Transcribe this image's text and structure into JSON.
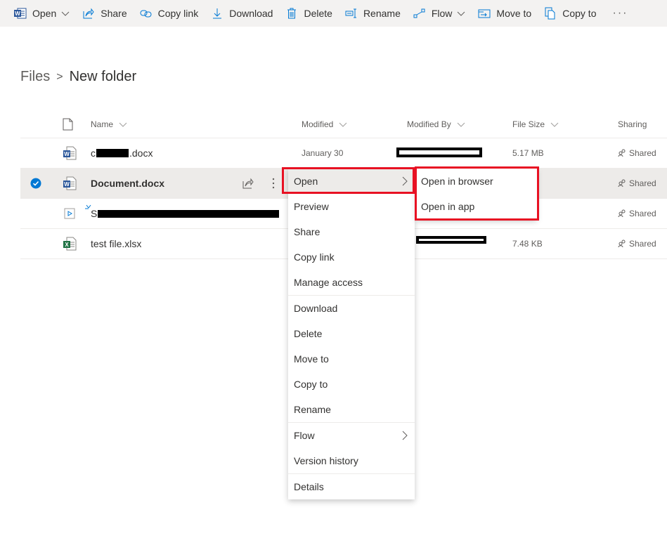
{
  "toolbar": {
    "items": [
      {
        "label": "Open",
        "icon": "word-icon",
        "dropdown": true
      },
      {
        "label": "Share",
        "icon": "share-icon"
      },
      {
        "label": "Copy link",
        "icon": "link-icon"
      },
      {
        "label": "Download",
        "icon": "download-icon"
      },
      {
        "label": "Delete",
        "icon": "trash-icon"
      },
      {
        "label": "Rename",
        "icon": "rename-icon"
      },
      {
        "label": "Flow",
        "icon": "flow-icon",
        "dropdown": true
      },
      {
        "label": "Move to",
        "icon": "move-icon"
      },
      {
        "label": "Copy to",
        "icon": "copy-icon"
      }
    ],
    "more": "···"
  },
  "breadcrumb": {
    "root": "Files",
    "separator": ">",
    "current": "New folder"
  },
  "columns": {
    "name": "Name",
    "modified": "Modified",
    "modified_by": "Modified By",
    "file_size": "File Size",
    "sharing": "Sharing"
  },
  "files": [
    {
      "name_prefix": "c",
      "name_suffix": ".docx",
      "type": "word",
      "modified": "January 30",
      "size": "5.17 MB",
      "sharing": "Shared"
    },
    {
      "name": "Document.docx",
      "type": "word",
      "modified": "",
      "size": "",
      "sharing": "Shared",
      "selected": true
    },
    {
      "name_prefix": "S",
      "type": "video",
      "modified": "",
      "size": "",
      "sharing": "Shared"
    },
    {
      "name": "test file.xlsx",
      "type": "excel",
      "modified": "",
      "size": "7.48 KB",
      "sharing": "Shared"
    }
  ],
  "context_menu": {
    "items": [
      {
        "label": "Open",
        "submenu": true
      },
      {
        "label": "Preview"
      },
      {
        "label": "Share"
      },
      {
        "label": "Copy link"
      },
      {
        "label": "Manage access"
      },
      {
        "label": "Download"
      },
      {
        "label": "Delete"
      },
      {
        "label": "Move to"
      },
      {
        "label": "Copy to"
      },
      {
        "label": "Rename"
      },
      {
        "label": "Flow",
        "submenu": true
      },
      {
        "label": "Version history"
      },
      {
        "label": "Details"
      }
    ]
  },
  "submenu": {
    "items": [
      {
        "label": "Open in browser"
      },
      {
        "label": "Open in app"
      }
    ]
  },
  "colors": {
    "accent": "#0078d4",
    "highlight": "#e81123",
    "selected_row": "#edebe9",
    "toolbar_bg": "#f3f2f1"
  }
}
